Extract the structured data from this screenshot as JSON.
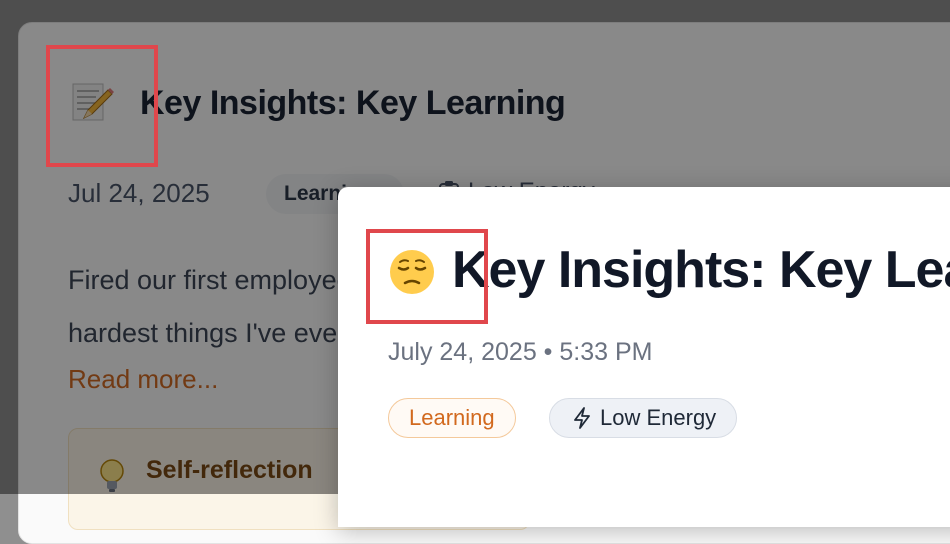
{
  "background_card": {
    "title": "Key Insights: Key Learning",
    "date": "Jul 24, 2025",
    "tag": "Learning",
    "energy": "Low Energy",
    "excerpt_lines": [
      "Fired our first employee today. One of the",
      "hardest things I've ever had to do."
    ],
    "read_more": "Read more...",
    "reflection_label": "Self-reflection",
    "emoji_icon": "memo-pencil-icon"
  },
  "modal": {
    "title": "Key Insights: Key Learning",
    "date": "July 24, 2025 • 5:33 PM",
    "tags": {
      "learning": "Learning",
      "energy": "Low Energy"
    },
    "emoji_icon": "pensive-face-icon"
  },
  "colors": {
    "accent_orange": "#d2691e",
    "highlight_red": "#e0474c",
    "title_dark": "#111827"
  }
}
